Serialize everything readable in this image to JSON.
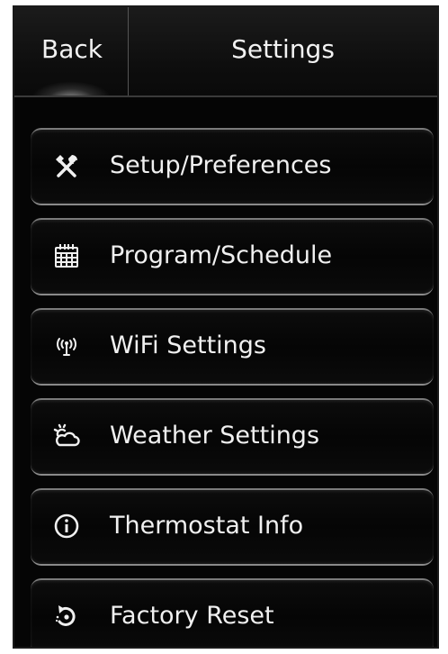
{
  "header": {
    "back_label": "Back",
    "title": "Settings"
  },
  "menu": {
    "items": [
      {
        "label": "Setup/Preferences",
        "icon": "tools-icon"
      },
      {
        "label": "Program/Schedule",
        "icon": "calendar-icon"
      },
      {
        "label": "WiFi Settings",
        "icon": "wifi-antenna-icon"
      },
      {
        "label": "Weather Settings",
        "icon": "weather-icon"
      },
      {
        "label": "Thermostat Info",
        "icon": "info-icon"
      },
      {
        "label": "Factory Reset",
        "icon": "reset-icon"
      }
    ]
  },
  "colors": {
    "background": "#050505",
    "text": "#f0f0f0",
    "button_border": "#8a8a8a"
  }
}
